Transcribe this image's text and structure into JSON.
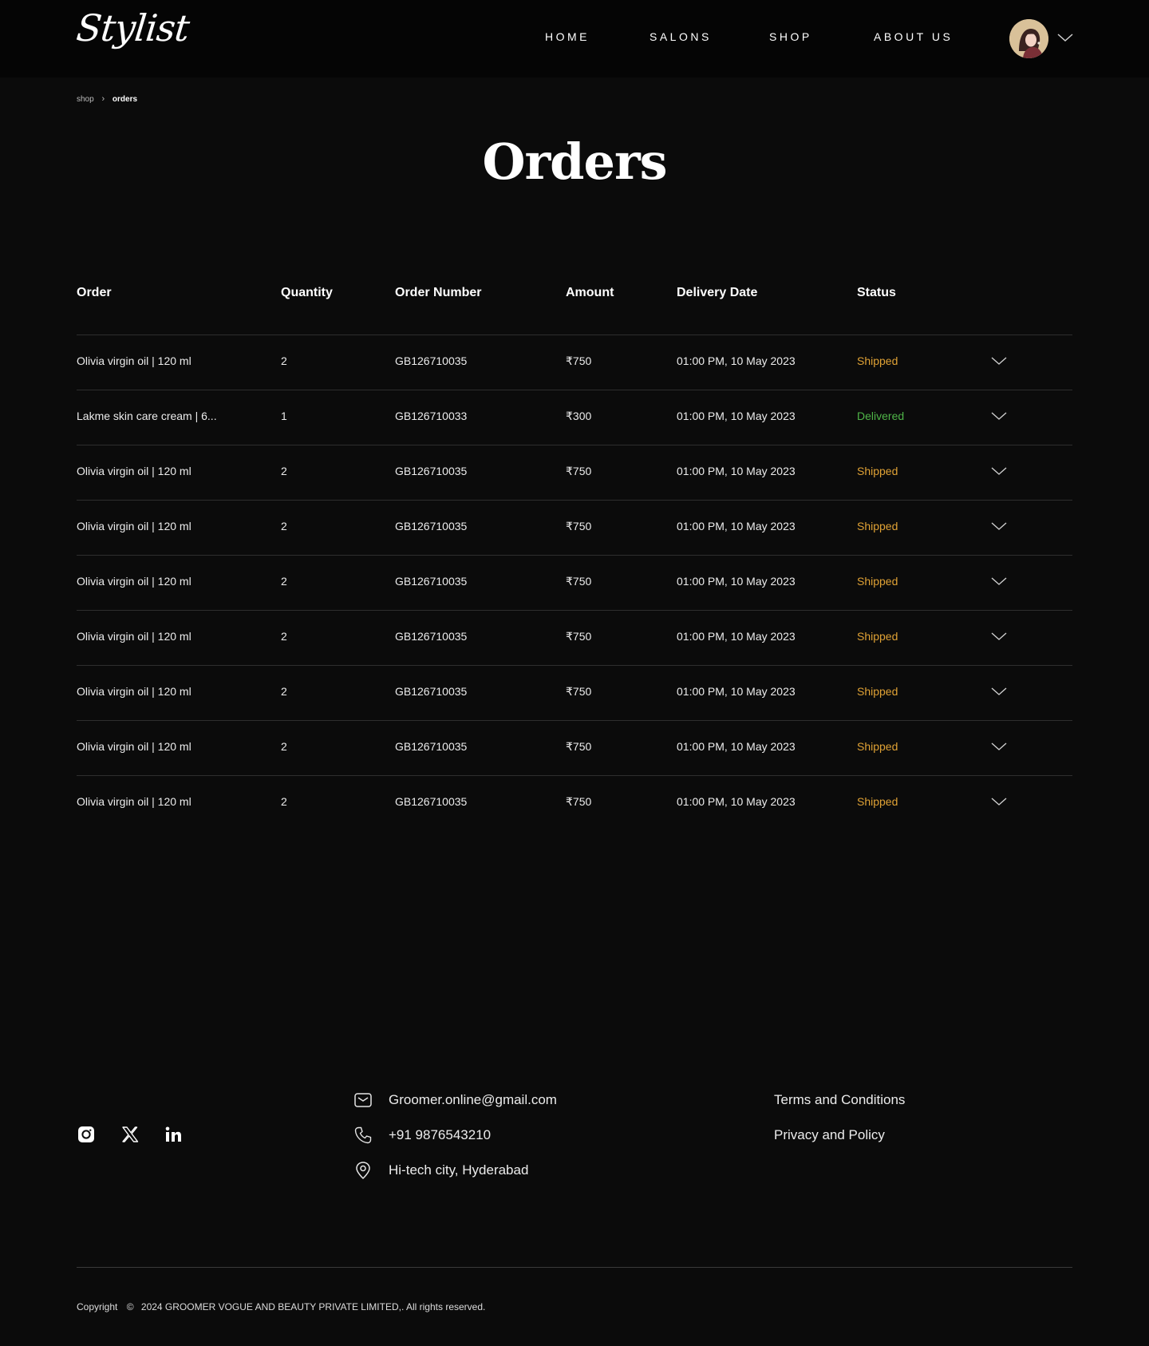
{
  "brand": {
    "logo_text": "Stylist"
  },
  "nav": {
    "items": [
      "HOME",
      "SALONS",
      "SHOP",
      "ABOUT US"
    ]
  },
  "breadcrumb": {
    "parent": "shop",
    "separator": "›",
    "current": "orders"
  },
  "page": {
    "title": "Orders"
  },
  "table": {
    "headers": [
      "Order",
      "Quantity",
      "Order Number",
      "Amount",
      "Delivery Date",
      "Status"
    ],
    "rows": [
      {
        "order": "Olivia virgin oil | 120 ml",
        "quantity": "2",
        "order_number": "GB126710035",
        "amount": "₹750",
        "delivery_date": "01:00 PM, 10 May 2023",
        "status": "Shipped"
      },
      {
        "order": "Lakme skin care cream | 6...",
        "quantity": "1",
        "order_number": "GB126710033",
        "amount": "₹300",
        "delivery_date": "01:00 PM, 10 May 2023",
        "status": "Delivered"
      },
      {
        "order": "Olivia virgin oil | 120 ml",
        "quantity": "2",
        "order_number": "GB126710035",
        "amount": "₹750",
        "delivery_date": "01:00 PM, 10 May 2023",
        "status": "Shipped"
      },
      {
        "order": "Olivia virgin oil | 120 ml",
        "quantity": "2",
        "order_number": "GB126710035",
        "amount": "₹750",
        "delivery_date": "01:00 PM, 10 May 2023",
        "status": "Shipped"
      },
      {
        "order": "Olivia virgin oil | 120 ml",
        "quantity": "2",
        "order_number": "GB126710035",
        "amount": "₹750",
        "delivery_date": "01:00 PM, 10 May 2023",
        "status": "Shipped"
      },
      {
        "order": "Olivia virgin oil | 120 ml",
        "quantity": "2",
        "order_number": "GB126710035",
        "amount": "₹750",
        "delivery_date": "01:00 PM, 10 May 2023",
        "status": "Shipped"
      },
      {
        "order": "Olivia virgin oil | 120 ml",
        "quantity": "2",
        "order_number": "GB126710035",
        "amount": "₹750",
        "delivery_date": "01:00 PM, 10 May 2023",
        "status": "Shipped"
      },
      {
        "order": "Olivia virgin oil | 120 ml",
        "quantity": "2",
        "order_number": "GB126710035",
        "amount": "₹750",
        "delivery_date": "01:00 PM, 10 May 2023",
        "status": "Shipped"
      },
      {
        "order": "Olivia virgin oil | 120 ml",
        "quantity": "2",
        "order_number": "GB126710035",
        "amount": "₹750",
        "delivery_date": "01:00 PM, 10 May 2023",
        "status": "Shipped"
      }
    ]
  },
  "status_colors": {
    "Shipped": "#e0a235",
    "Delivered": "#4fb548"
  },
  "footer": {
    "social_icons": [
      "instagram-icon",
      "x-icon",
      "linkedin-icon"
    ],
    "contact": {
      "email": "Groomer.online@gmail.com",
      "phone": "+91 9876543210",
      "address": "Hi-tech city, Hyderabad"
    },
    "links": {
      "terms": "Terms and Conditions",
      "privacy": "Privacy and Policy"
    },
    "copyright": {
      "label": "Copyright",
      "symbol": "©",
      "text": "2024 GROOMER VOGUE AND BEAUTY PRIVATE LIMITED,. All rights reserved."
    }
  }
}
